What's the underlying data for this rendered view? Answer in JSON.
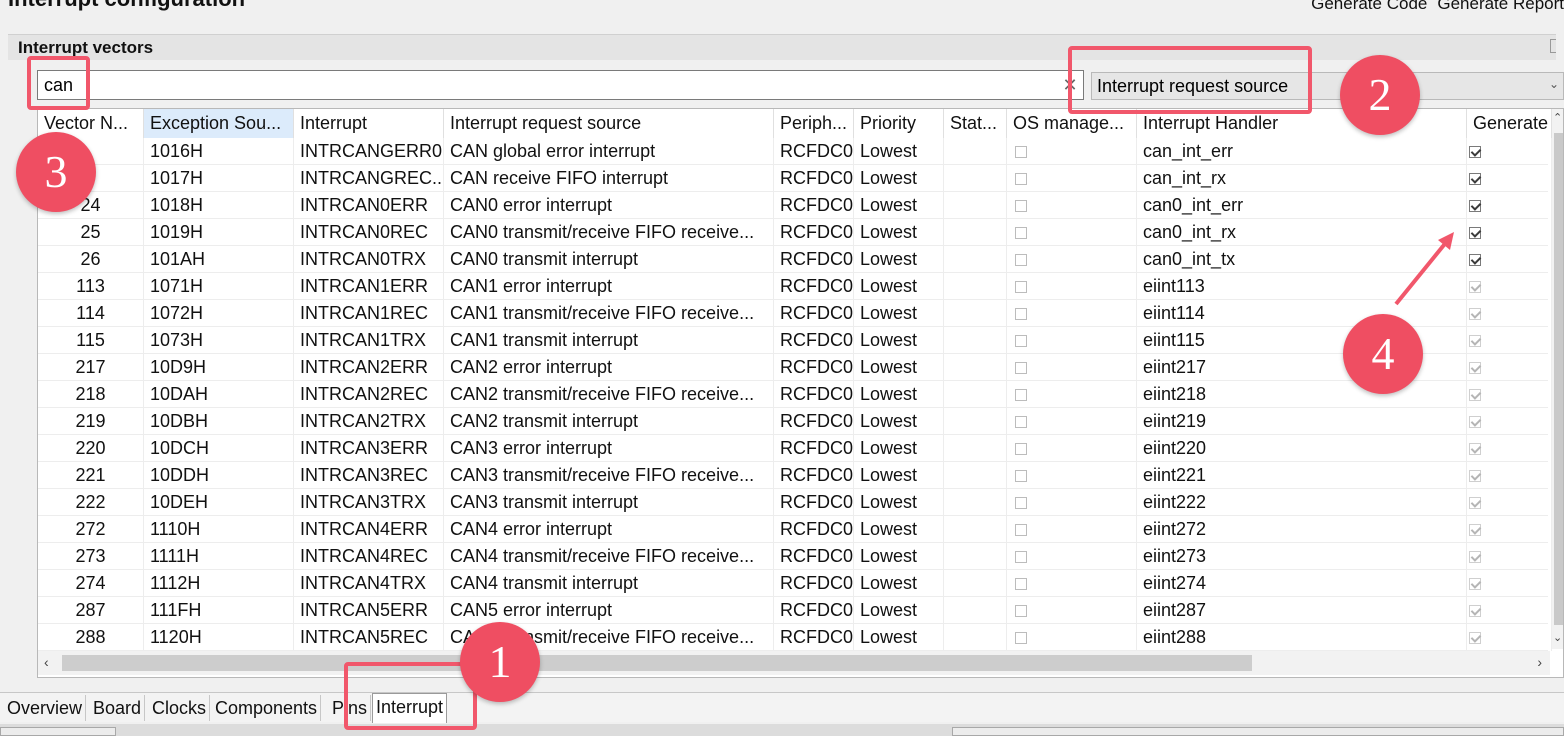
{
  "header": {
    "title": "Interrupt configuration",
    "generate_code": "Generate Code",
    "generate_report": "Generate Report"
  },
  "section": {
    "title": "Interrupt vectors"
  },
  "filter": {
    "value": "can",
    "source": "Interrupt request source"
  },
  "table": {
    "columns": [
      "Vector N...",
      "Exception Sou...",
      "Interrupt",
      "Interrupt request source",
      "Periph...",
      "Priority",
      "Stat...",
      "OS manage...",
      "Interrupt Handler",
      "Generate"
    ],
    "rows": [
      {
        "vector": "",
        "exception": "1016H",
        "interrupt": "INTRCANGERR0",
        "source": "CAN global error interrupt",
        "periph": "RCFDC0",
        "priority": "Lowest",
        "handler": "can_int_err",
        "generate": "on"
      },
      {
        "vector": "",
        "exception": "1017H",
        "interrupt": "INTRCANGREC...",
        "source": "CAN receive FIFO interrupt",
        "periph": "RCFDC0",
        "priority": "Lowest",
        "handler": "can_int_rx",
        "generate": "on"
      },
      {
        "vector": "24",
        "exception": "1018H",
        "interrupt": "INTRCAN0ERR",
        "source": "CAN0 error interrupt",
        "periph": "RCFDC0",
        "priority": "Lowest",
        "handler": "can0_int_err",
        "generate": "on"
      },
      {
        "vector": "25",
        "exception": "1019H",
        "interrupt": "INTRCAN0REC",
        "source": "CAN0 transmit/receive FIFO receive...",
        "periph": "RCFDC0",
        "priority": "Lowest",
        "handler": "can0_int_rx",
        "generate": "on"
      },
      {
        "vector": "26",
        "exception": "101AH",
        "interrupt": "INTRCAN0TRX",
        "source": "CAN0 transmit interrupt",
        "periph": "RCFDC0",
        "priority": "Lowest",
        "handler": "can0_int_tx",
        "generate": "on"
      },
      {
        "vector": "113",
        "exception": "1071H",
        "interrupt": "INTRCAN1ERR",
        "source": "CAN1 error interrupt",
        "periph": "RCFDC0",
        "priority": "Lowest",
        "handler": "eiint113",
        "generate": "dim"
      },
      {
        "vector": "114",
        "exception": "1072H",
        "interrupt": "INTRCAN1REC",
        "source": "CAN1 transmit/receive FIFO receive...",
        "periph": "RCFDC0",
        "priority": "Lowest",
        "handler": "eiint114",
        "generate": "dim"
      },
      {
        "vector": "115",
        "exception": "1073H",
        "interrupt": "INTRCAN1TRX",
        "source": "CAN1 transmit interrupt",
        "periph": "RCFDC0",
        "priority": "Lowest",
        "handler": "eiint115",
        "generate": "dim"
      },
      {
        "vector": "217",
        "exception": "10D9H",
        "interrupt": "INTRCAN2ERR",
        "source": "CAN2 error interrupt",
        "periph": "RCFDC0",
        "priority": "Lowest",
        "handler": "eiint217",
        "generate": "dim"
      },
      {
        "vector": "218",
        "exception": "10DAH",
        "interrupt": "INTRCAN2REC",
        "source": "CAN2 transmit/receive FIFO receive...",
        "periph": "RCFDC0",
        "priority": "Lowest",
        "handler": "eiint218",
        "generate": "dim"
      },
      {
        "vector": "219",
        "exception": "10DBH",
        "interrupt": "INTRCAN2TRX",
        "source": "CAN2 transmit interrupt",
        "periph": "RCFDC0",
        "priority": "Lowest",
        "handler": "eiint219",
        "generate": "dim"
      },
      {
        "vector": "220",
        "exception": "10DCH",
        "interrupt": "INTRCAN3ERR",
        "source": "CAN3 error interrupt",
        "periph": "RCFDC0",
        "priority": "Lowest",
        "handler": "eiint220",
        "generate": "dim"
      },
      {
        "vector": "221",
        "exception": "10DDH",
        "interrupt": "INTRCAN3REC",
        "source": "CAN3 transmit/receive FIFO receive...",
        "periph": "RCFDC0",
        "priority": "Lowest",
        "handler": "eiint221",
        "generate": "dim"
      },
      {
        "vector": "222",
        "exception": "10DEH",
        "interrupt": "INTRCAN3TRX",
        "source": "CAN3 transmit interrupt",
        "periph": "RCFDC0",
        "priority": "Lowest",
        "handler": "eiint222",
        "generate": "dim"
      },
      {
        "vector": "272",
        "exception": "1110H",
        "interrupt": "INTRCAN4ERR",
        "source": "CAN4 error interrupt",
        "periph": "RCFDC0",
        "priority": "Lowest",
        "handler": "eiint272",
        "generate": "dim"
      },
      {
        "vector": "273",
        "exception": "1111H",
        "interrupt": "INTRCAN4REC",
        "source": "CAN4 transmit/receive FIFO receive...",
        "periph": "RCFDC0",
        "priority": "Lowest",
        "handler": "eiint273",
        "generate": "dim"
      },
      {
        "vector": "274",
        "exception": "1112H",
        "interrupt": "INTRCAN4TRX",
        "source": "CAN4 transmit interrupt",
        "periph": "RCFDC0",
        "priority": "Lowest",
        "handler": "eiint274",
        "generate": "dim"
      },
      {
        "vector": "287",
        "exception": "111FH",
        "interrupt": "INTRCAN5ERR",
        "source": "CAN5 error interrupt",
        "periph": "RCFDC0",
        "priority": "Lowest",
        "handler": "eiint287",
        "generate": "dim"
      },
      {
        "vector": "288",
        "exception": "1120H",
        "interrupt": "INTRCAN5REC",
        "source": "CAN5 transmit/receive FIFO receive...",
        "periph": "RCFDC0",
        "priority": "Lowest",
        "handler": "eiint288",
        "generate": "dim"
      }
    ]
  },
  "tabs": [
    "Overview",
    "Board",
    "Clocks",
    "Components",
    "Pins",
    "Interrupt"
  ],
  "annotations": {
    "badges": [
      "1",
      "2",
      "3",
      "4"
    ],
    "color": "#f1576b"
  }
}
